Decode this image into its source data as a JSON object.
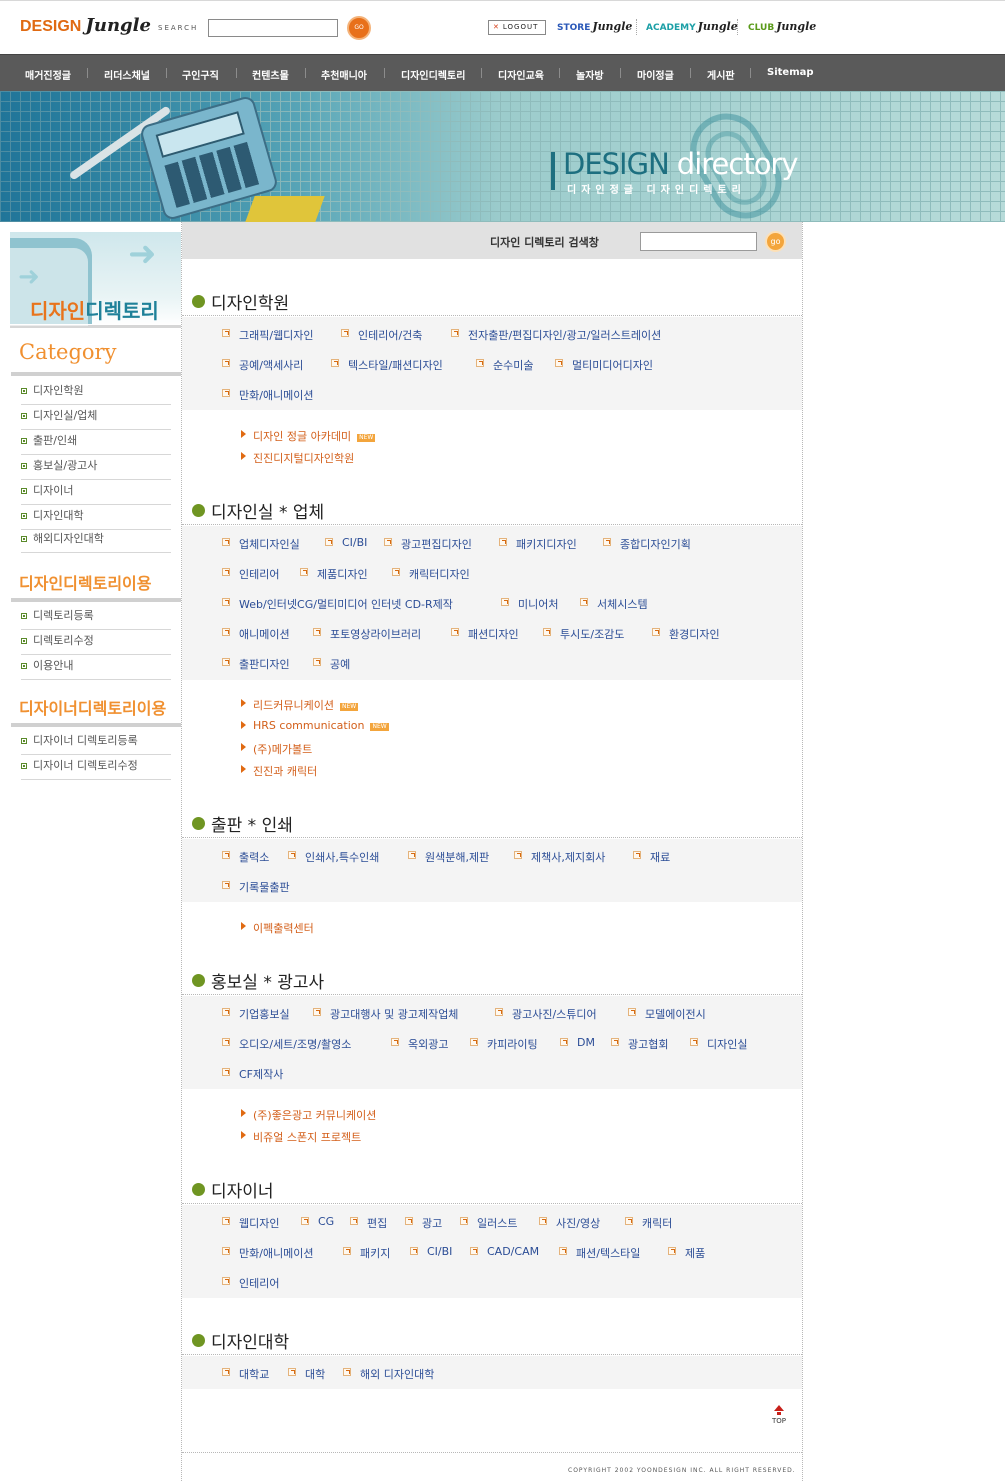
{
  "header": {
    "logo_text": "DESIGN",
    "logo_script": "Jungle",
    "search_label": "SEARCH",
    "search_value": "",
    "go_label": "GO",
    "logout_label": "LOGOUT",
    "links": [
      {
        "name": "STORE",
        "script": "Jungle"
      },
      {
        "name": "ACADEMY",
        "script": "Jungle"
      },
      {
        "name": "CLUB",
        "script": "Jungle"
      }
    ]
  },
  "nav": {
    "items": [
      "매거진정글",
      "리더스채널",
      "구인구직",
      "컨텐츠몰",
      "추천매니아",
      "디자인디렉토리",
      "디자인교육",
      "놀자방",
      "마이정글",
      "게시판",
      "Sitemap"
    ]
  },
  "banner": {
    "title_a": "DESIGN",
    "title_b": "directory",
    "subtitle": "디자인정글 디자인디렉토리"
  },
  "sidebar": {
    "title_a": "디자인",
    "title_b": "디렉토리",
    "category_heading": "Category",
    "categories": [
      "디자인학원",
      "디자인실/업체",
      "출판/인쇄",
      "홍보실/광고사",
      "디자이너",
      "디자인대학",
      "해외디자인대학"
    ],
    "usage_heading": "디자인디렉토리이용",
    "usage_items": [
      "디렉토리등록",
      "디렉토리수정",
      "이용안내"
    ],
    "designer_heading": "디자이너디렉토리이용",
    "designer_items": [
      "디자이너 디렉토리등록",
      "디자이너 디렉토리수정"
    ]
  },
  "directory_search": {
    "label": "디자인 디렉토리 검색창",
    "value": "",
    "go_label": "go"
  },
  "sections": [
    {
      "title": "디자인학원",
      "rows": [
        [
          "그래픽/웹디자인",
          "인테리어/건축",
          "전자출판/편집디자인/광고/일러스트레이션"
        ],
        [
          "공예/액세사리",
          "텍스타일/패션디자인",
          "순수미술",
          "멀티미디어디자인"
        ],
        [
          "만화/애니메이션"
        ]
      ],
      "featured": [
        {
          "label": "디자인 정글 아카데미",
          "new": true
        },
        {
          "label": "진진디지털디자인학원",
          "new": false
        }
      ]
    },
    {
      "title": "디자인실 * 업체",
      "rows": [
        [
          "업체디자인실",
          "CI/BI",
          "광고편집디자인",
          "패키지디자인",
          "종합디자인기획"
        ],
        [
          "인테리어",
          "제품디자인",
          "캐릭터디자인"
        ],
        [
          "Web/인터넷CG/멀티미디어 인터넷 CD-R제작",
          "미니어처",
          "서체시스템"
        ],
        [
          "애니메이션",
          "포토영상라이브러리",
          "패션디자인",
          "투시도/조감도",
          "환경디자인"
        ],
        [
          "출판디자인",
          "공예"
        ]
      ],
      "featured": [
        {
          "label": "리드커뮤니케이션",
          "new": true
        },
        {
          "label": "HRS communication",
          "new": true
        },
        {
          "label": "(주)메가볼트",
          "new": false
        },
        {
          "label": "진진과 캐릭터",
          "new": false
        }
      ]
    },
    {
      "title": "출판 * 인쇄",
      "rows": [
        [
          "출력소",
          "인쇄사,특수인쇄",
          "원색분해,제판",
          "제책사,제지회사",
          "재료"
        ],
        [
          "기록물출판"
        ]
      ],
      "featured": [
        {
          "label": "이펙출력센터",
          "new": false
        }
      ]
    },
    {
      "title": "홍보실 * 광고사",
      "rows": [
        [
          "기업홍보실",
          "광고대행사 및 광고제작업체",
          "광고사진/스튜디어",
          "모델에이전시"
        ],
        [
          "오디오/세트/조명/촬영소",
          "옥외광고",
          "카피라이팅",
          "DM",
          "광고협회",
          "디자인실"
        ],
        [
          "CF제작사"
        ]
      ],
      "featured": [
        {
          "label": "(주)좋은광고 커뮤니케이션",
          "new": false
        },
        {
          "label": "비쥬얼 스폰지 프로젝트",
          "new": false
        }
      ]
    },
    {
      "title": "디자이너",
      "rows": [
        [
          "웹디자인",
          "CG",
          "편집",
          "광고",
          "일러스트",
          "사진/영상",
          "캐릭터"
        ],
        [
          "만화/애니메이션",
          "패키지",
          "CI/BI",
          "CAD/CAM",
          "패션/텍스타일",
          "제품"
        ],
        [
          "인테리어"
        ]
      ],
      "featured": []
    },
    {
      "title": "디자인대학",
      "rows": [
        [
          "대학교",
          "대학",
          "해외 디자인대학"
        ]
      ],
      "featured": []
    }
  ],
  "new_badge": "NEW",
  "top_label": "TOP",
  "copyright": "COPYRIGHT 2002 YOONDESIGN INC. ALL RIGHT RESERVED."
}
